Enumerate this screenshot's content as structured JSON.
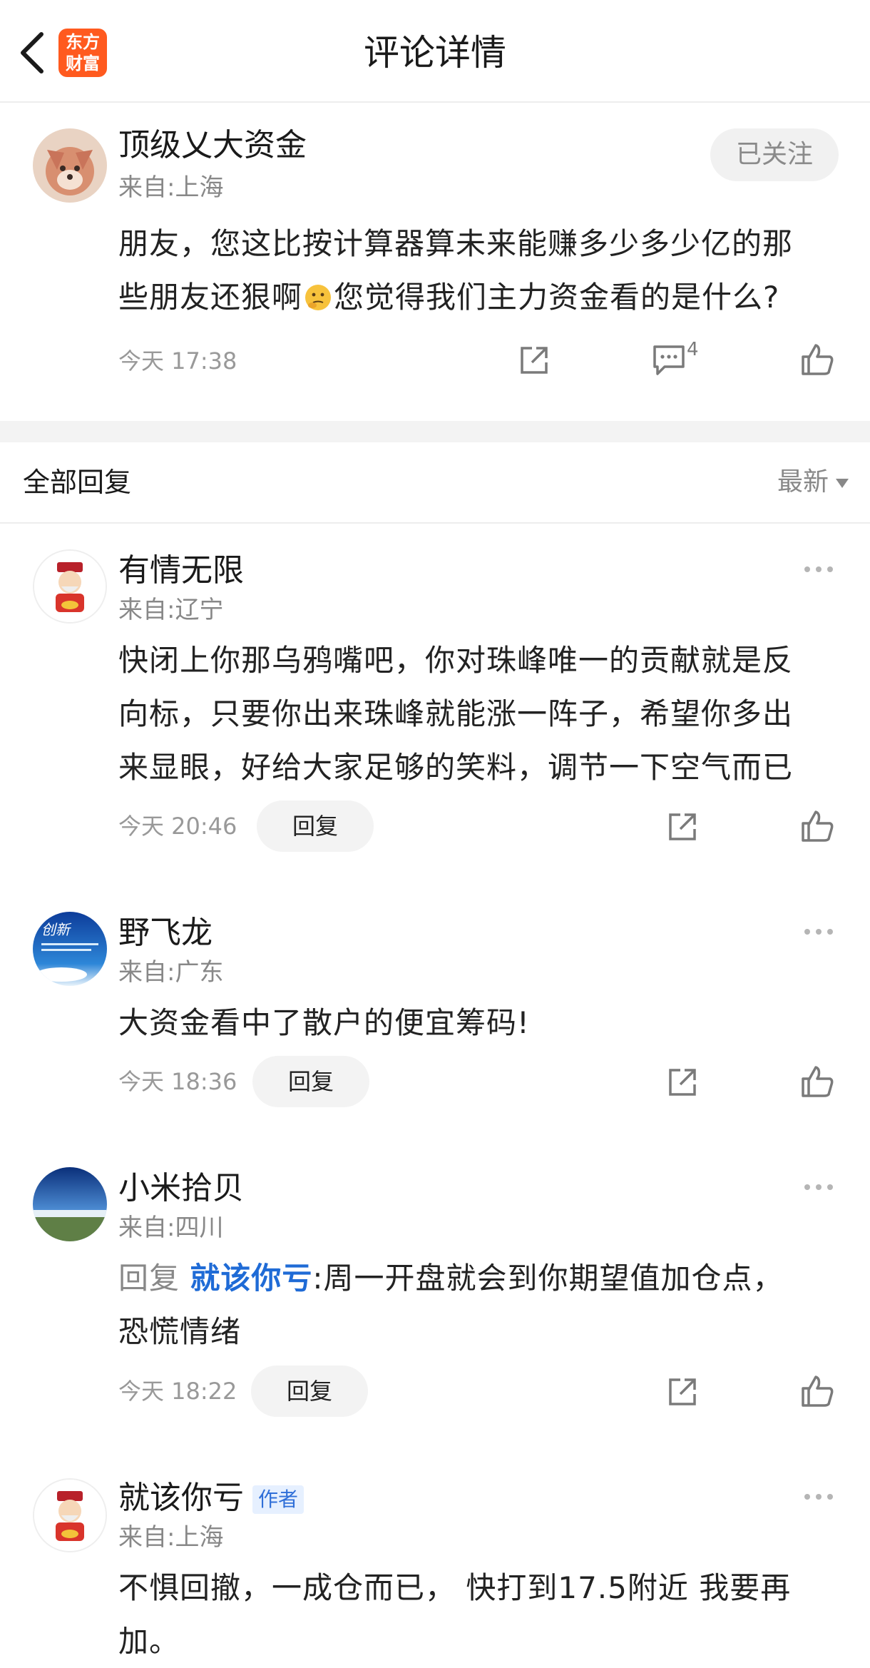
{
  "header": {
    "title": "评论详情",
    "logo_line1": "东方",
    "logo_line2": "财富"
  },
  "main_comment": {
    "username": "顶级乂大资金",
    "location": "来自:上海",
    "follow_label": "已关注",
    "text_line1": "朋友，您这比按计算器算未来能赚多少多少亿的那",
    "text_line2a": "些朋友还狠啊",
    "text_line2b": "您觉得我们主力资金看的是什么?",
    "time": "今天 17:38",
    "comment_count": "4"
  },
  "replies_header": {
    "title": "全部回复",
    "sort_label": "最新"
  },
  "replies": [
    {
      "username": "有情无限",
      "location": "来自:辽宁",
      "lines": [
        "快闭上你那乌鸦嘴吧，你对珠峰唯一的贡献就是反",
        "向标，只要你出来珠峰就能涨一阵子，希望你多出",
        "来显眼，好给大家足够的笑料，调节一下空气而已"
      ],
      "time": "今天 20:46",
      "reply_label": "回复"
    },
    {
      "username": "野飞龙",
      "location": "来自:广东",
      "lines": [
        "大资金看中了散户的便宜筹码!"
      ],
      "time": "今天 18:36",
      "reply_label": "回复",
      "avatar_text": "创新"
    },
    {
      "username": "小米拾贝",
      "location": "来自:四川",
      "reply_prefix": "回复",
      "reply_target": "就该你亏",
      "lines": [
        ":周一开盘就会到你期望值加仓点，",
        "恐慌情绪"
      ],
      "time": "今天 18:22",
      "reply_label": "回复"
    },
    {
      "username": "就该你亏",
      "badge": "作者",
      "location": "来自:上海",
      "lines": [
        "不惧回撤，一成仓而已， 快打到17.5附近 我要再",
        "加。"
      ]
    }
  ]
}
